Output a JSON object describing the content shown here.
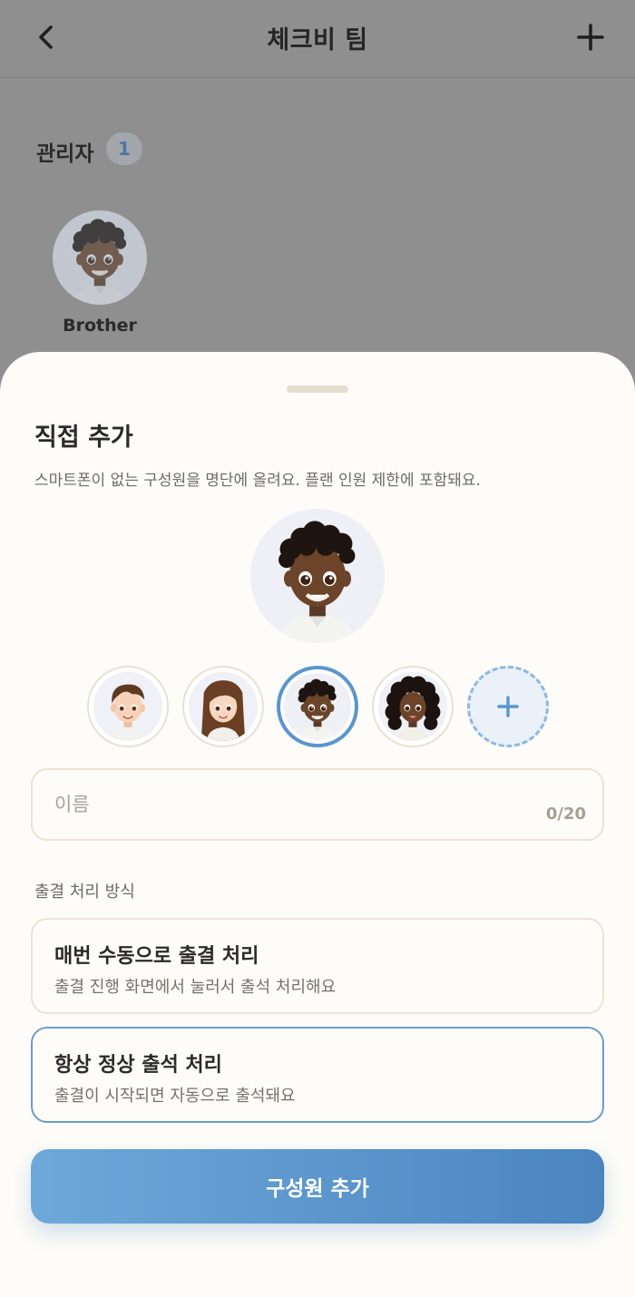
{
  "header": {
    "title": "체크비 팀",
    "back_icon": "chevron-left-icon",
    "add_icon": "plus-icon"
  },
  "admin_section": {
    "label": "관리자",
    "count": "1",
    "members": [
      {
        "name": "Brother",
        "avatar": "boy-curly-dark-avatar"
      }
    ]
  },
  "sheet": {
    "title": "직접 추가",
    "description": "스마트폰이 없는 구성원을 명단에 올려요. 플랜 인원 제한에 포함돼요.",
    "avatar_choices": [
      {
        "avatar": "boy-brown-hair-avatar",
        "selected": false
      },
      {
        "avatar": "girl-long-brown-hair-avatar",
        "selected": false
      },
      {
        "avatar": "boy-curly-dark-avatar",
        "selected": true
      },
      {
        "avatar": "girl-curly-dark-avatar",
        "selected": false
      },
      {
        "avatar": "add-avatar-plus-icon",
        "selected": false
      }
    ],
    "name_field": {
      "placeholder": "이름",
      "value": "",
      "counter": "0/20"
    },
    "mode_label": "출결 처리 방식",
    "options": [
      {
        "title": "매번 수동으로 출결 처리",
        "description": "출결 진행 화면에서 눌러서 출석 처리해요",
        "selected": false
      },
      {
        "title": "항상 정상 출석 처리",
        "description": "출결이 시작되면 자동으로 출석돼요",
        "selected": true
      }
    ],
    "submit_label": "구성원 추가"
  },
  "colors": {
    "accent": "#5b95cd",
    "button_gradient_start": "#6ea8da",
    "button_gradient_end": "#4a85bf",
    "sheet_background": "#fdfcf8",
    "overlay_background": "#8f8f8f",
    "border": "#ebe3d5"
  }
}
